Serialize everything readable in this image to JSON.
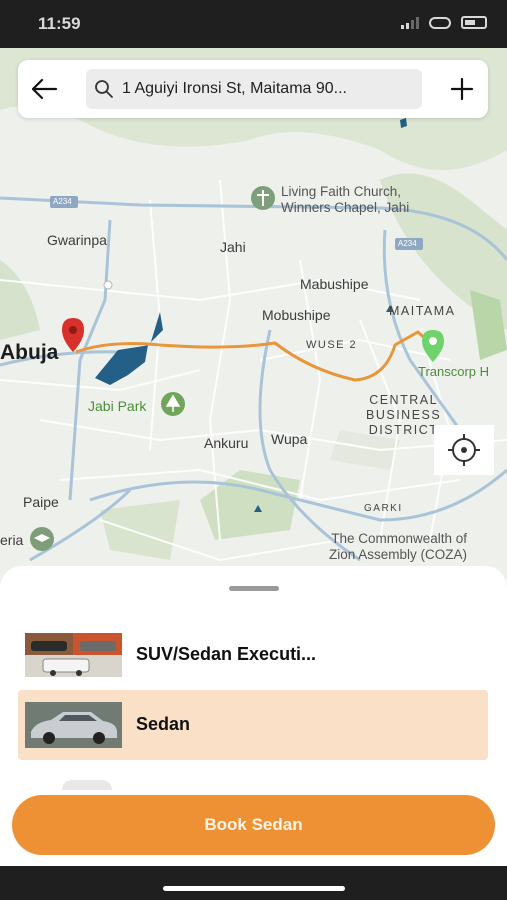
{
  "status_bar": {
    "time": "11:59"
  },
  "search": {
    "value": "1 Aguiyi Ironsi St, Maitama 90..."
  },
  "map": {
    "labels": {
      "church": "Living Faith Church,\nWinners Chapel, Jahi",
      "gwarinpa": "Gwarinpa",
      "jahi": "Jahi",
      "mabushipe": "Mabushipe",
      "mobushipe": "Mobushipe",
      "maitama": "MAITAMA",
      "wuse2": "WUSE 2",
      "abuja": "Abuja",
      "jabi_park": "Jabi Park",
      "transcorp": "Transcorp H",
      "cbd": "CENTRAL\nBUSINESS\nDISTRICT",
      "ankuru": "Ankuru",
      "wupa": "Wupa",
      "paipe": "Paipe",
      "garki": "GARKI",
      "eria": "eria",
      "coza": "The Commonwealth of\nZion Assembly (COZA)",
      "road_a234": "A234",
      "road_a234b": "A234"
    }
  },
  "ride_options": [
    {
      "label": "SUV/Sedan Executi...",
      "selected": false
    },
    {
      "label": "Sedan",
      "selected": true
    }
  ],
  "book_button": {
    "label": "Book Sedan"
  },
  "colors": {
    "accent": "#ee9135",
    "selected_bg": "#fae0c6",
    "route": "#e8963c"
  }
}
